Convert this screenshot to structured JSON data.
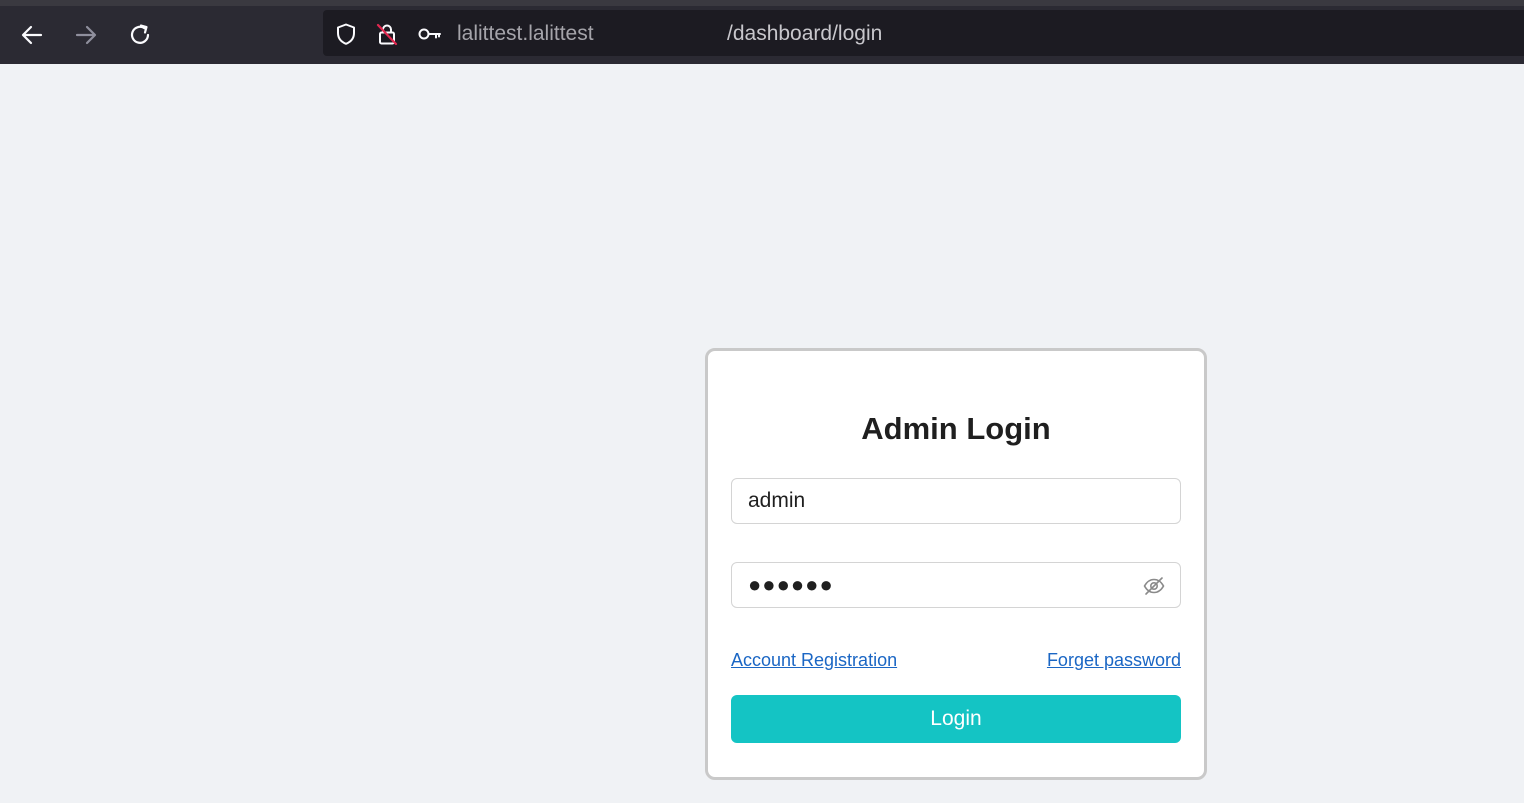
{
  "browser": {
    "url_host": "lalittest.lalittest",
    "url_path": "/dashboard/login",
    "icons": {
      "back": "back-arrow-icon",
      "forward": "forward-arrow-icon",
      "reload": "reload-icon",
      "shield": "shield-icon",
      "insecure_lock": "insecure-lock-icon",
      "key": "key-icon"
    },
    "colors": {
      "toolbar_bg": "#2b2a33",
      "urlbar_bg": "#1c1b22"
    }
  },
  "login": {
    "title": "Admin Login",
    "username_value": "admin",
    "password_display": "●●●●●●",
    "account_registration_label": "Account Registration",
    "forget_password_label": "Forget password",
    "login_button_label": "Login",
    "eye_icon": "eye-slash-icon",
    "colors": {
      "accent": "#14c4c4",
      "link": "#1a66c4",
      "page_bg": "#f0f2f5"
    }
  }
}
